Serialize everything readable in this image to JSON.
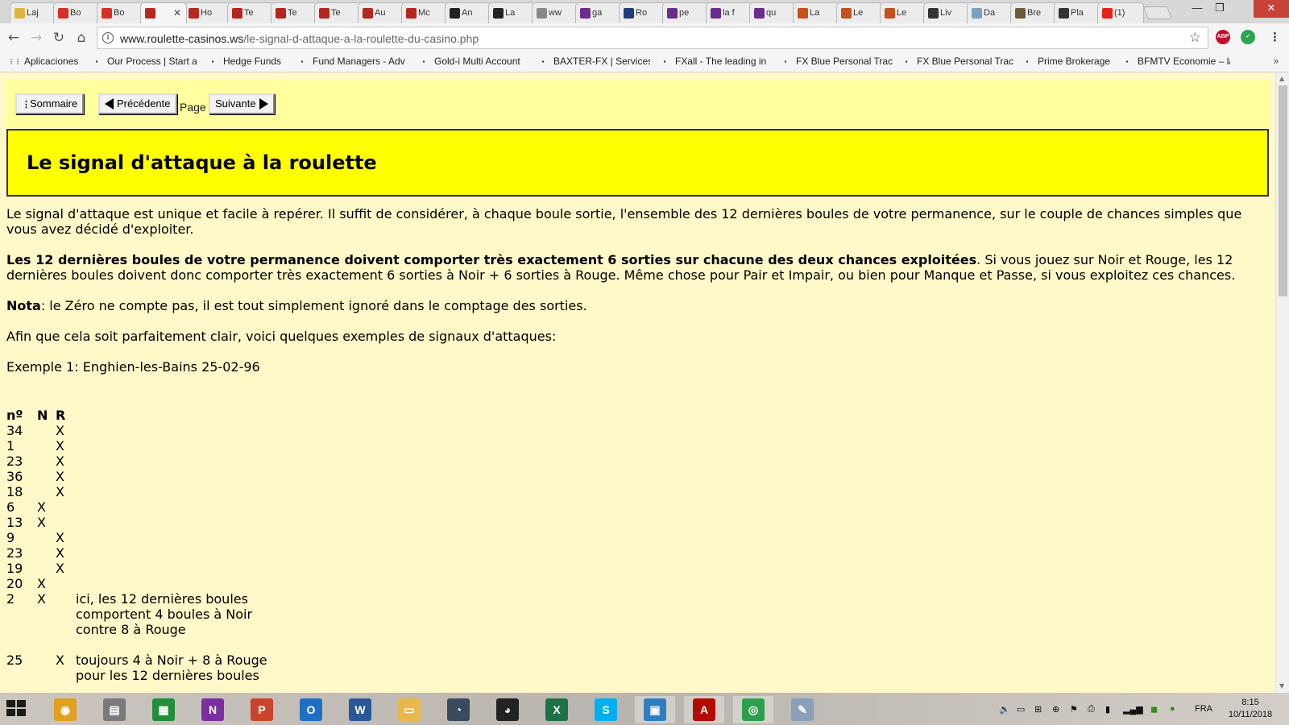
{
  "browser": {
    "tabs": [
      {
        "label": "Laj",
        "icon": "yellow-tab-icon",
        "color": "#e3b23c"
      },
      {
        "label": "Bo",
        "icon": "gmail-icon",
        "color": "#d93025"
      },
      {
        "label": "Bo",
        "icon": "gmail-icon",
        "color": "#d93025"
      },
      {
        "label": "",
        "icon": "roulette-icon",
        "color": "#b5261e",
        "active": true
      },
      {
        "label": "Ho",
        "icon": "roulette-icon",
        "color": "#b5261e"
      },
      {
        "label": "Te",
        "icon": "roulette-icon",
        "color": "#b5261e"
      },
      {
        "label": "Te",
        "icon": "roulette-icon",
        "color": "#b5261e"
      },
      {
        "label": "Te",
        "icon": "roulette-icon",
        "color": "#b5261e"
      },
      {
        "label": "Au",
        "icon": "roulette-icon",
        "color": "#b5261e"
      },
      {
        "label": "Mc",
        "icon": "roulette-icon",
        "color": "#b5261e"
      },
      {
        "label": "An",
        "icon": "amazon-icon",
        "color": "#222222"
      },
      {
        "label": "La",
        "icon": "amazon-icon",
        "color": "#222222"
      },
      {
        "label": "ww",
        "icon": "page-icon",
        "color": "#888888"
      },
      {
        "label": "ga",
        "icon": "m-purple-icon",
        "color": "#6a2c8e"
      },
      {
        "label": "Ro",
        "icon": "sj-icon",
        "color": "#1f3b7a"
      },
      {
        "label": "pe",
        "icon": "m-purple-icon",
        "color": "#6a2c8e"
      },
      {
        "label": "la f",
        "icon": "m-purple-icon",
        "color": "#6a2c8e"
      },
      {
        "label": "qu",
        "icon": "m-purple-icon",
        "color": "#6a2c8e"
      },
      {
        "label": "La",
        "icon": "orange-book-icon",
        "color": "#c4501b"
      },
      {
        "label": "Le",
        "icon": "orange-book-icon",
        "color": "#c4501b"
      },
      {
        "label": "Le",
        "icon": "orange-book-icon",
        "color": "#c4501b"
      },
      {
        "label": "Liv",
        "icon": "plus-icon",
        "color": "#333333"
      },
      {
        "label": "Da",
        "icon": "cat-icon",
        "color": "#7aa0c0"
      },
      {
        "label": "Bre",
        "icon": "bird-icon",
        "color": "#6b5a3a"
      },
      {
        "label": "Pla",
        "icon": "anchor-icon",
        "color": "#333333"
      },
      {
        "label": "(1)",
        "icon": "youtube-icon",
        "color": "#e62117"
      }
    ],
    "active_tab_close": "✕",
    "url_host": "www.roulette-casinos.ws",
    "url_path": "/le-signal-d-attaque-a-la-roulette-du-casino.php",
    "window_controls": {
      "minimize": "—",
      "maximize": "❐",
      "close": "✕"
    },
    "bookmarks": [
      {
        "label": "Aplicaciones",
        "icon": "apps-grid-icon"
      },
      {
        "label": "Our Process | Start a",
        "icon": "page-icon"
      },
      {
        "label": "Hedge Funds",
        "icon": "sh-icon"
      },
      {
        "label": "Fund Managers - Adv",
        "icon": "fm-icon"
      },
      {
        "label": "Gold-i Multi Account",
        "icon": "gold-i-icon"
      },
      {
        "label": "BAXTER-FX | Services",
        "icon": "baxter-icon"
      },
      {
        "label": "FXall - The leading in",
        "icon": "fxall-icon"
      },
      {
        "label": "FX Blue Personal Trac",
        "icon": "fxblue-icon"
      },
      {
        "label": "FX Blue Personal Trac",
        "icon": "fxblue-icon"
      },
      {
        "label": "Prime Brokerage",
        "icon": "prime-icon"
      },
      {
        "label": "BFMTV Economie – la",
        "icon": "bfmtv-icon"
      }
    ],
    "bookmarks_more": "»",
    "extensions": [
      {
        "label": "ABP",
        "icon": "adblock-icon",
        "color": "#c70d2c"
      },
      {
        "label": "✓",
        "icon": "check-icon",
        "color": "#2ea44f"
      }
    ]
  },
  "page": {
    "nav": {
      "sommaire": "Sommaire",
      "precedente": "Précédente",
      "page_label": "Page",
      "suivante": "Suivante"
    },
    "title": "Le signal d'attaque à la roulette",
    "para1": "Le signal d'attaque est unique et facile à repérer. Il suffit de considérer, à chaque boule sortie, l'ensemble des 12 dernières boules de votre permanence, sur le couple de chances simples que vous avez décidé d'exploiter.",
    "para2_bold": "Les 12 dernières boules de votre permanence doivent comporter très exactement 6 sorties sur chacune des deux chances exploitées",
    "para2_rest": ". Si vous jouez sur Noir et Rouge, les 12 dernières boules doivent donc comporter très exactement 6 sorties à Noir + 6 sorties à Rouge. Même chose pour Pair et Impair, ou bien pour Manque et Passe, si vous exploitez ces chances.",
    "para3_bold": "Nota",
    "para3_rest": ": le Zéro ne compte pas, il est tout simplement ignoré dans le comptage des sorties.",
    "para4": "Afin que cela soit parfaitement clair, voici quelques exemples de signaux d'attaques:",
    "para5": "Exemple 1: Enghien-les-Bains 25-02-96",
    "table": {
      "headers": {
        "num": "nº",
        "noir": "N",
        "rouge": "R"
      },
      "rows": [
        {
          "num": "34",
          "noir": "",
          "rouge": "X",
          "note": []
        },
        {
          "num": "1",
          "noir": "",
          "rouge": "X",
          "note": []
        },
        {
          "num": "23",
          "noir": "",
          "rouge": "X",
          "note": []
        },
        {
          "num": "36",
          "noir": "",
          "rouge": "X",
          "note": []
        },
        {
          "num": "18",
          "noir": "",
          "rouge": "X",
          "note": []
        },
        {
          "num": "6",
          "noir": "X",
          "rouge": "",
          "note": []
        },
        {
          "num": "13",
          "noir": "X",
          "rouge": "",
          "note": []
        },
        {
          "num": "9",
          "noir": "",
          "rouge": "X",
          "note": []
        },
        {
          "num": "23",
          "noir": "",
          "rouge": "X",
          "note": []
        },
        {
          "num": "19",
          "noir": "",
          "rouge": "X",
          "note": []
        },
        {
          "num": "20",
          "noir": "X",
          "rouge": "",
          "note": []
        },
        {
          "num": "2",
          "noir": "X",
          "rouge": "",
          "note": [
            "ici, les 12 dernières boules",
            "comportent 4 boules à Noir",
            "contre 8 à Rouge"
          ]
        },
        {
          "num": "",
          "noir": "",
          "rouge": "",
          "note": []
        },
        {
          "num": "25",
          "noir": "",
          "rouge": "X",
          "note": [
            "toujours 4 à Noir + 8 à Rouge",
            "pour les 12 dernières boules"
          ]
        }
      ]
    }
  },
  "taskbar": {
    "apps": [
      {
        "name": "chrome-canary-app",
        "glyph": "◉",
        "color": "#e0a020"
      },
      {
        "name": "scanner-app",
        "glyph": "▤",
        "color": "#7a7a7a"
      },
      {
        "name": "calculator-app",
        "glyph": "▦",
        "color": "#1f8f3a"
      },
      {
        "name": "onenote-app",
        "glyph": "N",
        "color": "#7b2f9e"
      },
      {
        "name": "powerpoint-app",
        "glyph": "P",
        "color": "#c9442a"
      },
      {
        "name": "outlook-app",
        "glyph": "O",
        "color": "#1f6fc4"
      },
      {
        "name": "word-app",
        "glyph": "W",
        "color": "#2b5797"
      },
      {
        "name": "file-explorer-app",
        "glyph": "▭",
        "color": "#e8b84a"
      },
      {
        "name": "hootsuite-app",
        "glyph": "◔",
        "color": "#3a4a5a"
      },
      {
        "name": "owl-app",
        "glyph": "◕",
        "color": "#222222"
      },
      {
        "name": "excel-app",
        "glyph": "X",
        "color": "#1e7145"
      },
      {
        "name": "skype-app",
        "glyph": "S",
        "color": "#00aff0"
      },
      {
        "name": "control-panel-app",
        "glyph": "▣",
        "color": "#2f7fc0"
      },
      {
        "name": "acrobat-app",
        "glyph": "A",
        "color": "#b30b00"
      },
      {
        "name": "chrome-app",
        "glyph": "◎",
        "color": "#2d9f4c"
      },
      {
        "name": "paint-app",
        "glyph": "✎",
        "color": "#8a9fb8"
      }
    ],
    "language": "FRA",
    "time": "8:15",
    "date": "10/11/2018"
  },
  "colors": {
    "page_bg": "#fff8c8",
    "navbar_bg": "#ffff9e",
    "title_bg": "#ffff00"
  }
}
